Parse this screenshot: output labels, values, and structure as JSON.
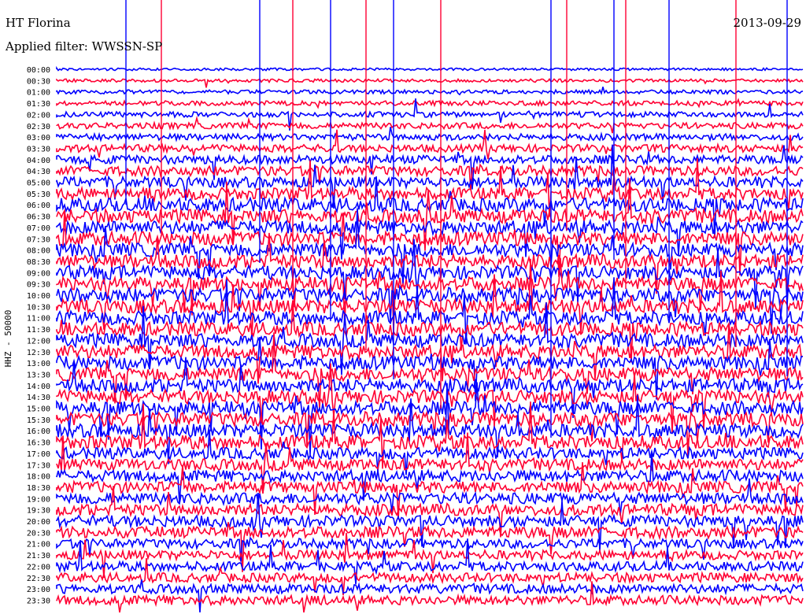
{
  "header": {
    "station": "HT Florina",
    "date": "2013-09-29",
    "filter": "Applied filter: WWSSN-SP",
    "channel": "HHZ - 50000"
  },
  "colors": {
    "trace_a": "#0000ff",
    "trace_b": "#ff0033",
    "background": "#ffffff",
    "text": "#000000"
  },
  "chart_data": {
    "type": "line",
    "title": "HT Florina",
    "subtitle": "Applied filter: WWSSN-SP",
    "ylabel": "HHZ - 50000",
    "rows": [
      "00:00",
      "00:30",
      "01:00",
      "01:30",
      "02:00",
      "02:30",
      "03:00",
      "03:30",
      "04:00",
      "04:30",
      "05:00",
      "05:30",
      "06:00",
      "06:30",
      "07:00",
      "07:30",
      "08:00",
      "08:30",
      "09:00",
      "09:30",
      "10:00",
      "10:30",
      "11:00",
      "11:30",
      "12:00",
      "12:30",
      "13:00",
      "13:30",
      "14:00",
      "14:30",
      "15:00",
      "15:30",
      "16:00",
      "16:30",
      "17:00",
      "17:30",
      "18:00",
      "18:30",
      "19:00",
      "19:30",
      "20:00",
      "20:30",
      "21:00",
      "21:30",
      "22:00",
      "22:30",
      "23:00",
      "23:30"
    ],
    "series": [
      {
        "color": "#0000ff"
      },
      {
        "color": "#ff0033"
      }
    ],
    "grid": false,
    "legend": "none"
  }
}
